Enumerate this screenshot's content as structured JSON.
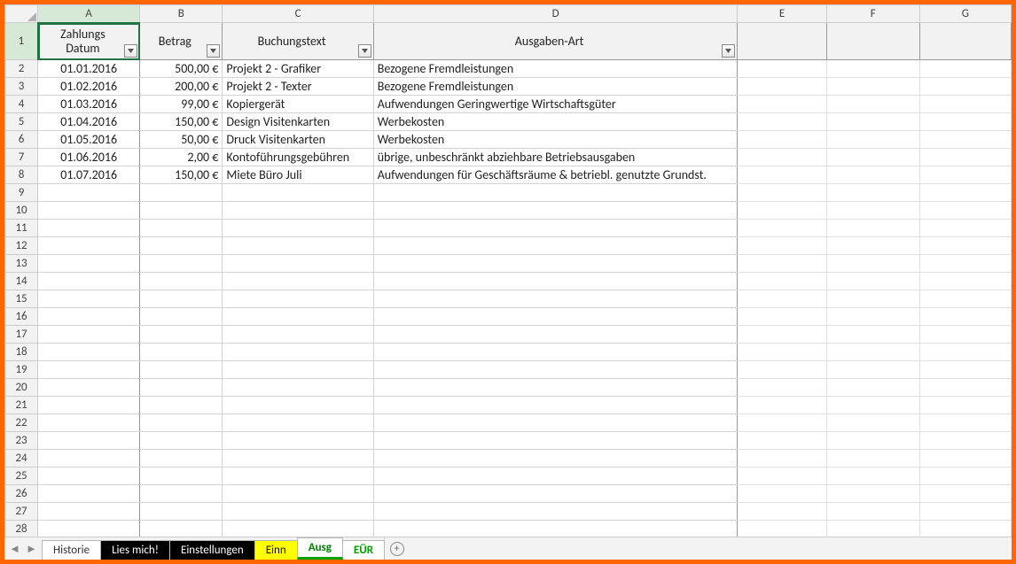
{
  "columns": [
    "A",
    "B",
    "C",
    "D",
    "E",
    "F",
    "G"
  ],
  "header": {
    "A": "Zahlungs\nDatum",
    "B": "Betrag",
    "C": "Buchungstext",
    "D": "Ausgaben-Art"
  },
  "rows": [
    {
      "n": 2,
      "A": "01.01.2016",
      "B": "500,00 €",
      "C": "Projekt 2 - Grafiker",
      "D": "Bezogene Fremdleistungen"
    },
    {
      "n": 3,
      "A": "01.02.2016",
      "B": "200,00 €",
      "C": "Projekt 2 - Texter",
      "D": "Bezogene Fremdleistungen"
    },
    {
      "n": 4,
      "A": "01.03.2016",
      "B": "99,00 €",
      "C": "Kopiergerät",
      "D": "Aufwendungen Geringwertige Wirtschaftsgüter"
    },
    {
      "n": 5,
      "A": "01.04.2016",
      "B": "150,00 €",
      "C": "Design Visitenkarten",
      "D": "Werbekosten"
    },
    {
      "n": 6,
      "A": "01.05.2016",
      "B": "50,00 €",
      "C": "Druck Visitenkarten",
      "D": "Werbekosten"
    },
    {
      "n": 7,
      "A": "01.06.2016",
      "B": "2,00 €",
      "C": "Kontoführungsgebühren",
      "D": "übrige, unbeschränkt abziehbare Betriebsausgaben"
    },
    {
      "n": 8,
      "A": "01.07.2016",
      "B": "150,00 €",
      "C": "Miete Büro Juli",
      "D": "Aufwendungen für Geschäftsräume & betriebl. genutzte Grundst."
    }
  ],
  "empty_rows": [
    9,
    10,
    11,
    12,
    13,
    14,
    15,
    16,
    17,
    18,
    19,
    20,
    21,
    22,
    23,
    24,
    25,
    26,
    27,
    28
  ],
  "tabs": [
    {
      "label": "Historie",
      "style": "hist"
    },
    {
      "label": "Lies mich!",
      "style": "black"
    },
    {
      "label": "Einstellungen",
      "style": "black"
    },
    {
      "label": "Einn",
      "style": "yellow"
    },
    {
      "label": "Ausg",
      "style": "active"
    },
    {
      "label": "EÜR",
      "style": "eur"
    }
  ],
  "nav": {
    "prev": "◄",
    "next": "►",
    "add": "+"
  }
}
